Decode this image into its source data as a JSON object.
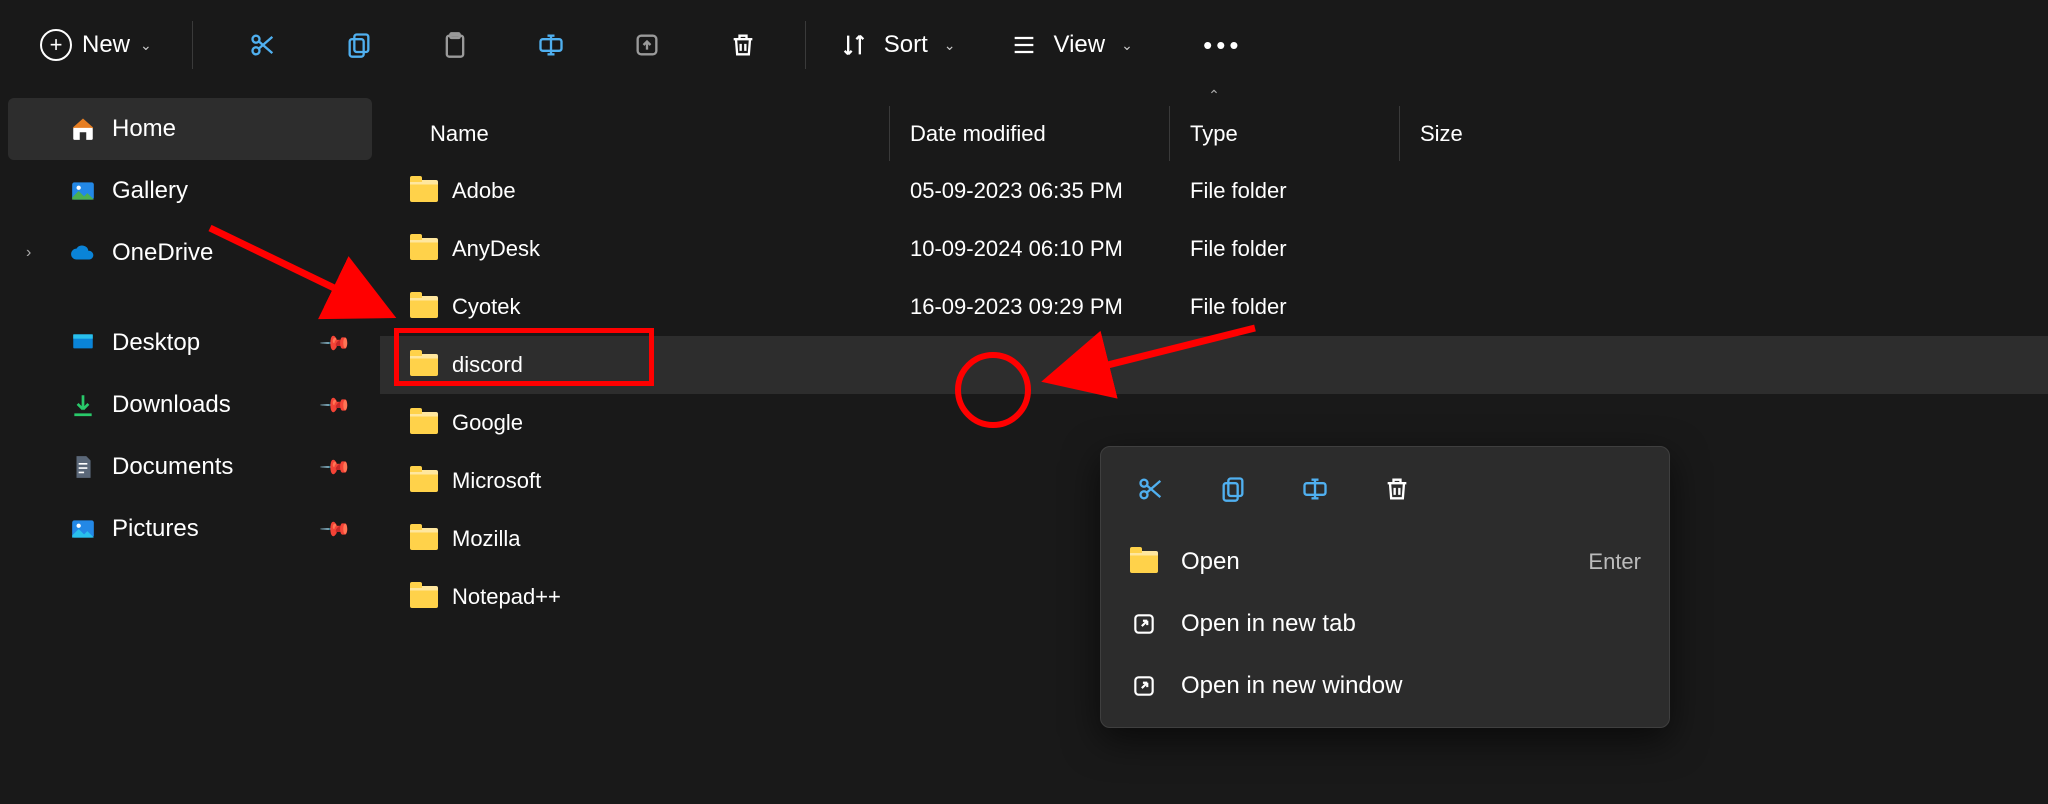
{
  "toolbar": {
    "new_label": "New",
    "sort_label": "Sort",
    "view_label": "View"
  },
  "sidebar": {
    "home": "Home",
    "gallery": "Gallery",
    "onedrive": "OneDrive",
    "desktop": "Desktop",
    "downloads": "Downloads",
    "documents": "Documents",
    "pictures": "Pictures"
  },
  "columns": {
    "name": "Name",
    "date": "Date modified",
    "type": "Type",
    "size": "Size"
  },
  "files": [
    {
      "name": "Adobe",
      "date": "05-09-2023 06:35 PM",
      "type": "File folder"
    },
    {
      "name": "AnyDesk",
      "date": "10-09-2024 06:10 PM",
      "type": "File folder"
    },
    {
      "name": "Cyotek",
      "date": "16-09-2023 09:29 PM",
      "type": "File folder"
    },
    {
      "name": "discord",
      "date": "",
      "type": ""
    },
    {
      "name": "Google",
      "date": "",
      "type": ""
    },
    {
      "name": "Microsoft",
      "date": "",
      "type": ""
    },
    {
      "name": "Mozilla",
      "date": "",
      "type": ""
    },
    {
      "name": "Notepad++",
      "date": "",
      "type": ""
    }
  ],
  "contextmenu": {
    "open": "Open",
    "open_shortcut": "Enter",
    "open_new_tab": "Open in new tab",
    "open_new_window": "Open in new window"
  }
}
